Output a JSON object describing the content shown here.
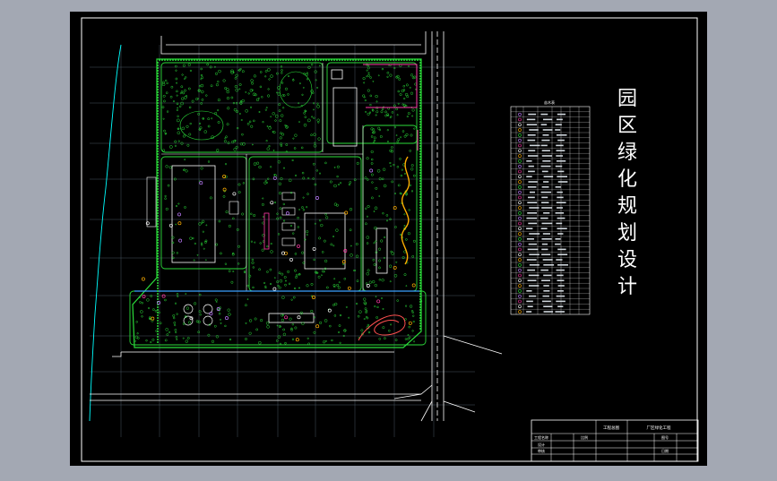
{
  "drawing": {
    "title_vertical": [
      "园",
      "区",
      "绿",
      "化",
      "规",
      "划",
      "设",
      "计"
    ],
    "title_block": {
      "drawing_name": "工程总图",
      "project": "厂区绿化工程",
      "row_labels": [
        "工程名称",
        "设计",
        "审核"
      ],
      "row_values": [
        "",
        "",
        ""
      ],
      "cells_right": [
        "比例",
        "",
        "图号",
        "",
        "日期",
        ""
      ]
    },
    "legend_table": {
      "caption": "苗木表",
      "rows": 40
    }
  },
  "colors": {
    "background": "#000000",
    "frame": "#ffffff",
    "outer_bg": "#a3a8b3",
    "road": "#ffffff",
    "grid": "#5a6a7a",
    "river": "#00ffff",
    "vegetation": "#2bdc3a",
    "building": "#ffffff",
    "path": "#ff3aa7",
    "flower": "#c07cff",
    "accent": "#ffae00"
  }
}
